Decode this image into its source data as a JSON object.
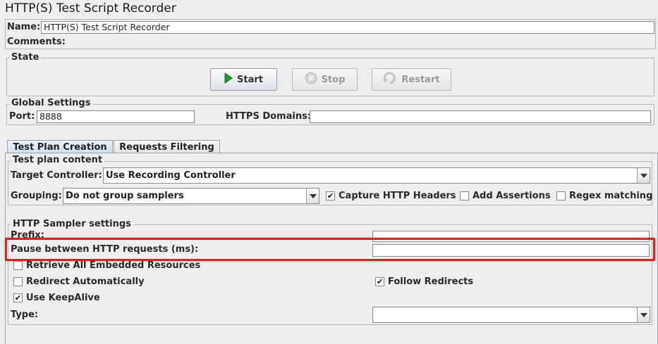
{
  "window": {
    "title": "HTTP(S) Test Script Recorder"
  },
  "name": {
    "label": "Name:",
    "value": "HTTP(S) Test Script Recorder"
  },
  "comments": {
    "label": "Comments:",
    "value": ""
  },
  "state": {
    "legend": "State",
    "start_label": "Start",
    "stop_label": "Stop",
    "restart_label": "Restart"
  },
  "global": {
    "legend": "Global Settings",
    "port_label": "Port:",
    "port_value": "8888",
    "https_label": "HTTPS Domains:",
    "https_value": ""
  },
  "tabs": [
    {
      "label": "Test Plan Creation",
      "active": true
    },
    {
      "label": "Requests Filtering",
      "active": false
    }
  ],
  "test_plan": {
    "legend": "Test plan content",
    "target_label": "Target Controller:",
    "target_value": "Use Recording Controller",
    "grouping_label": "Grouping:",
    "grouping_value": "Do not group samplers",
    "capture_headers_label": "Capture HTTP Headers",
    "capture_headers_checked": true,
    "add_assertions_label": "Add Assertions",
    "add_assertions_checked": false,
    "regex_label": "Regex matching",
    "regex_checked": false
  },
  "sampler": {
    "legend": "HTTP Sampler settings",
    "prefix_label": "Prefix:",
    "prefix_value": "",
    "pause_label": "Pause between HTTP requests (ms):",
    "pause_value": "",
    "retrieve_label": "Retrieve All Embedded Resources",
    "retrieve_checked": false,
    "redirect_label": "Redirect Automatically",
    "redirect_checked": false,
    "follow_label": "Follow Redirects",
    "follow_checked": true,
    "keepalive_label": "Use KeepAlive",
    "keepalive_checked": true,
    "type_label": "Type:",
    "type_value": ""
  },
  "colors": {
    "highlight": "#d42424",
    "start_icon": "#1f9a2a"
  },
  "icons": {
    "start": "play-icon",
    "stop": "stop-icon",
    "restart": "restart-icon",
    "dropdown": "chevron-down-icon",
    "check": "check-icon"
  }
}
